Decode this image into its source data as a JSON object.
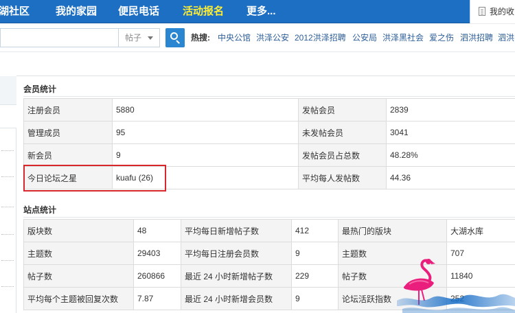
{
  "nav": {
    "items": [
      "湖社区",
      "我的家园",
      "便民电话",
      "活动报名",
      "更多..."
    ],
    "active": "活动报名",
    "mine": "我的收"
  },
  "search": {
    "placeholder": "",
    "type_selected": "帖子",
    "hot_label": "热搜:",
    "hot_links": [
      "中央公馆",
      "洪泽公安",
      "2012洪泽招聘",
      "公安局",
      "洪泽黑社会",
      "爱之伤",
      "泗洪招聘",
      "泗洪"
    ]
  },
  "member_stats": {
    "title": "会员统计",
    "rows": [
      [
        "注册会员",
        "5880",
        "发帖会员",
        "2839"
      ],
      [
        "管理成员",
        "95",
        "未发帖会员",
        "3041"
      ],
      [
        "新会员",
        "9",
        "发帖会员占总数",
        "48.28%"
      ],
      [
        "今日论坛之星",
        "kuafu (26)",
        "平均每人发帖数",
        "44.36"
      ]
    ]
  },
  "site_stats": {
    "title": "站点统计",
    "rows": [
      [
        "版块数",
        "48",
        "平均每日新增帖子数",
        "412",
        "最热门的版块",
        "大湖水库"
      ],
      [
        "主题数",
        "29403",
        "平均每日注册会员数",
        "9",
        "主题数",
        "707"
      ],
      [
        "帖子数",
        "260866",
        "最近 24 小时新增帖子数",
        "229",
        "帖子数",
        "11840"
      ],
      [
        "平均每个主题被回复次数",
        "7.87",
        "最近 24 小时新增会员数",
        "9",
        "论坛活跃指数",
        "252"
      ]
    ]
  },
  "colors": {
    "nav_bg": "#1d6fc3",
    "nav_active": "#ffee33",
    "link": "#2b5d97",
    "highlight": "#d7272a"
  }
}
